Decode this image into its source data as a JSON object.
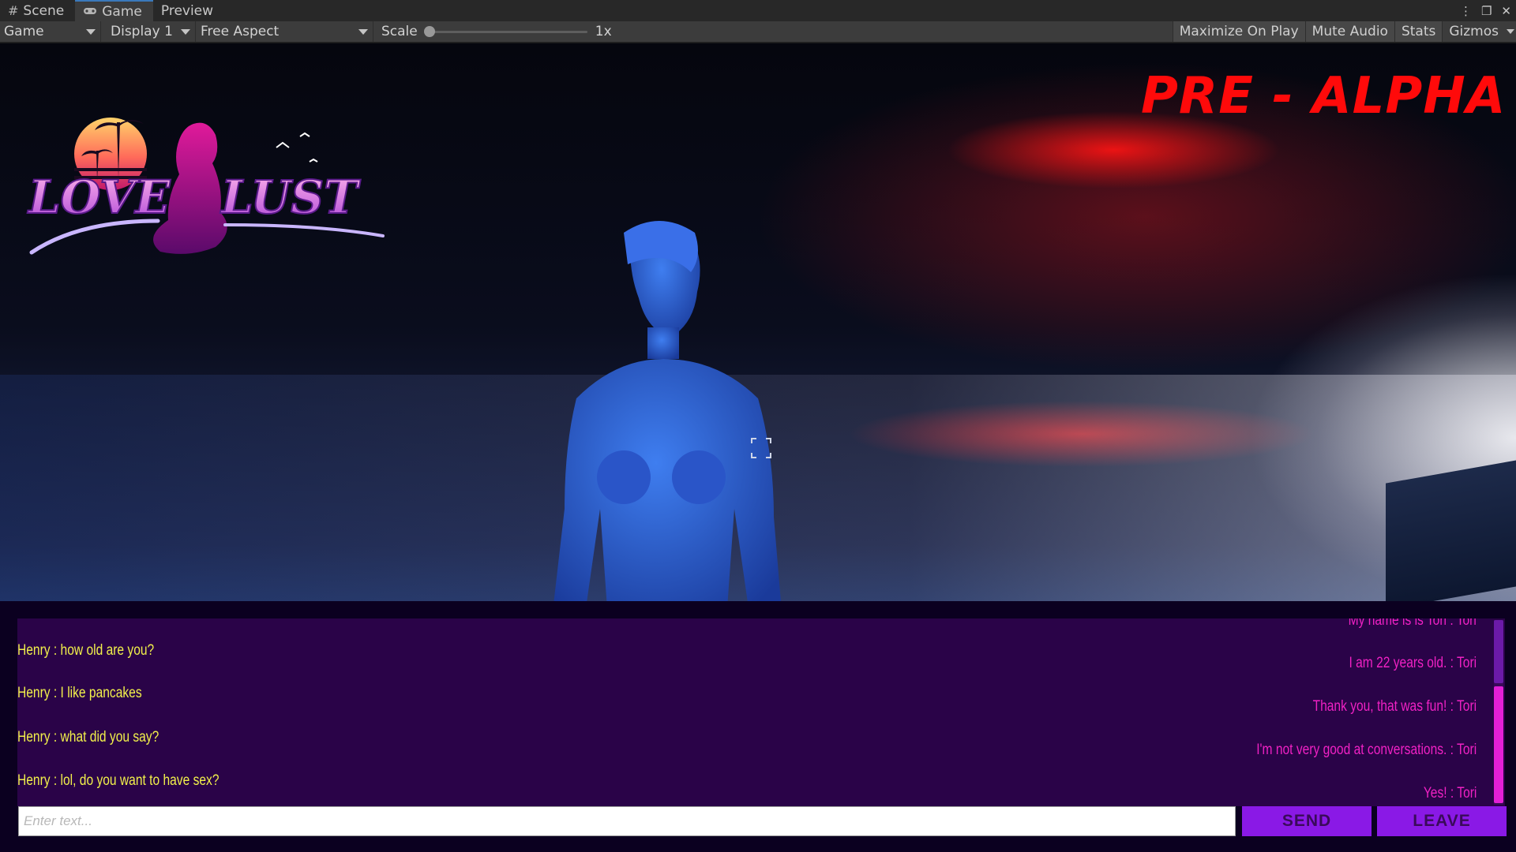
{
  "tabs": [
    {
      "label": "Scene",
      "icon": "grid-icon"
    },
    {
      "label": "Game",
      "icon": "gamepad-icon",
      "active": true
    },
    {
      "label": "Preview"
    }
  ],
  "toolbar": {
    "game_label": "Game",
    "display_label": "Display 1",
    "aspect_label": "Free Aspect",
    "scale_label": "Scale",
    "scale_value": "1x",
    "maximize_label": "Maximize On Play",
    "mute_label": "Mute Audio",
    "stats_label": "Stats",
    "gizmos_label": "Gizmos"
  },
  "game": {
    "logo_word_left": "LOVE",
    "logo_word_right": "LUST",
    "banner": "PRE - ALPHA"
  },
  "chat": {
    "player_messages": [
      "Henry : how old are you?",
      "Henry : I like pancakes",
      "Henry : what did you say?",
      "Henry : lol, do you want to have sex?"
    ],
    "npc_messages": [
      "My name is is Tori : Tori",
      "I am 22 years old. : Tori",
      "Thank you, that was fun! : Tori",
      "I'm not very good at conversations. : Tori",
      "Yes! : Tori"
    ],
    "input_placeholder": "Enter text...",
    "send_label": "SEND",
    "leave_label": "LEAVE"
  },
  "colors": {
    "player_text": "#f2f14a",
    "npc_text": "#f021c4",
    "chat_bg": "#2a0348",
    "button": "#8a19e6",
    "banner": "#ff0a0a"
  }
}
